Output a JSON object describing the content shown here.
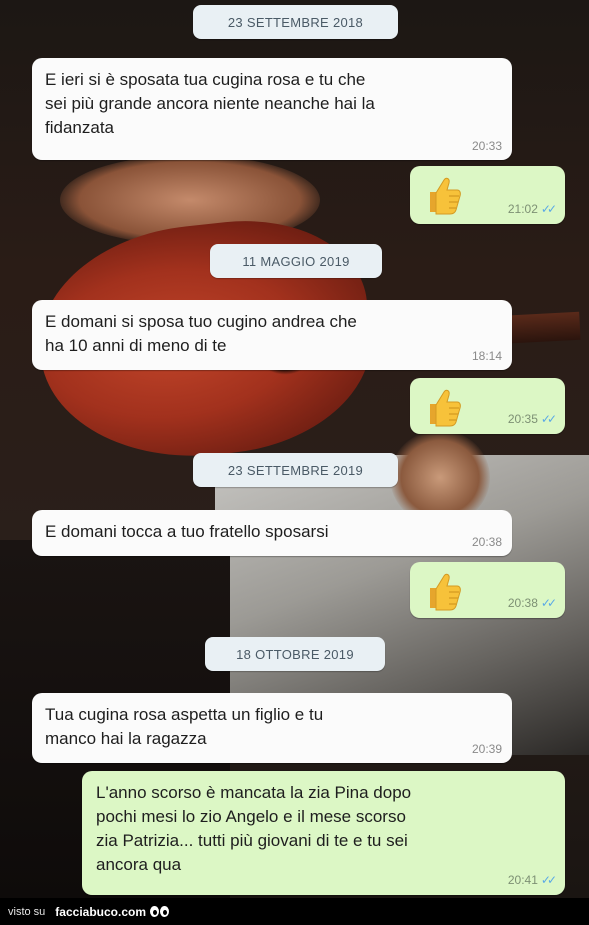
{
  "dates": {
    "d1": "23 SETTEMBRE 2018",
    "d2": "11 MAGGIO 2019",
    "d3": "23 SETTEMBRE 2019",
    "d4": "18 OTTOBRE 2019"
  },
  "messages": {
    "m1": {
      "line1": "E ieri si è sposata tua cugina rosa e tu che",
      "line2": "sei più grande ancora niente neanche hai la",
      "line3": "fidanzata",
      "time": "20:33"
    },
    "m2": {
      "time": "21:02"
    },
    "m3": {
      "line1": "E domani si sposa tuo cugino andrea che",
      "line2": "ha 10 anni di meno di te",
      "time": "18:14"
    },
    "m4": {
      "time": "20:35"
    },
    "m5": {
      "line1": "E domani tocca a tuo fratello sposarsi",
      "time": "20:38"
    },
    "m6": {
      "time": "20:38"
    },
    "m7": {
      "line1": "Tua cugina rosa aspetta un figlio e tu",
      "line2": "manco hai la ragazza",
      "time": "20:39"
    },
    "m8": {
      "line1": "L'anno scorso è mancata la zia Pina dopo",
      "line2": "pochi mesi lo zio Angelo e il mese scorso",
      "line3": "zia Patrizia... tutti più giovani di te e tu sei",
      "line4": "ancora qua",
      "time": "20:41"
    }
  },
  "icons": {
    "thumbs_up": "thumbs-up-emoji",
    "read_receipt": "double-check-icon"
  },
  "footer": {
    "visto": "visto su",
    "site": "facciabuco.com"
  }
}
